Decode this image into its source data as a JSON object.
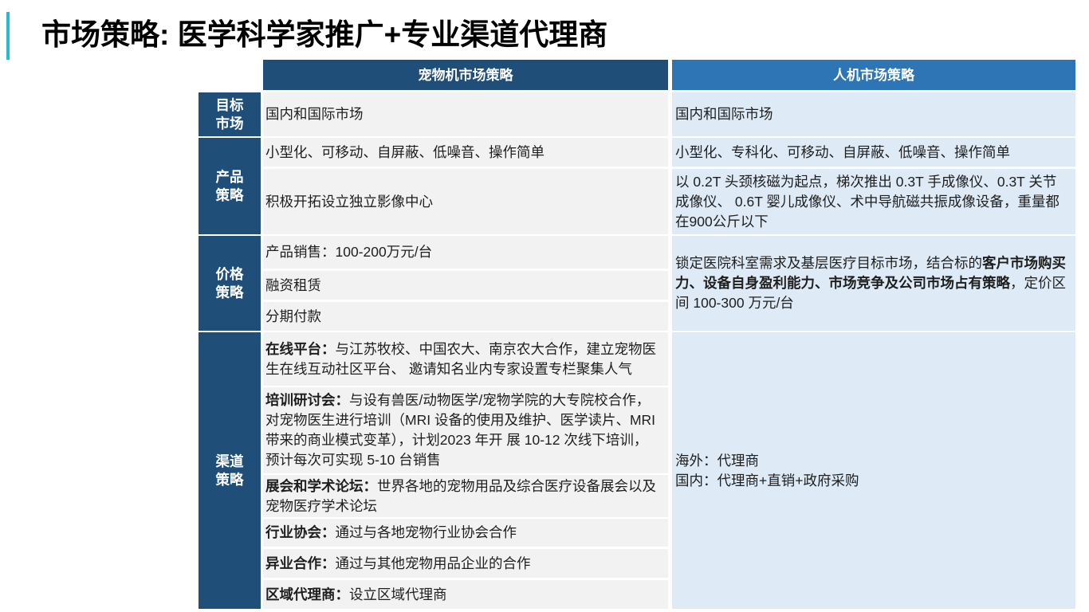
{
  "title": "市场策略: 医学科学家推广+专业渠道代理商",
  "colors": {
    "accent_bar": "#2BB9D0",
    "title_text": "#000000",
    "pet_header_bg": "#1F4E79",
    "human_header_bg": "#2E75B6",
    "row_label_bg": "#1F4E79",
    "pet_cell_bg": "#F2F2F2",
    "human_cell_bg": "#DEEBF7"
  },
  "table": {
    "headers": {
      "pet": "宠物机市场策略",
      "human": "人机市场策略"
    },
    "rows": {
      "target_market": {
        "label": "目标市场",
        "pet": "国内和国际市场",
        "human": "国内和国际市场"
      },
      "product_strategy": {
        "label": "产品策略",
        "pet": [
          "小型化、可移动、自屏蔽、低噪音、操作简单",
          "积极开拓设立独立影像中心"
        ],
        "human": [
          "小型化、专科化、可移动、自屏蔽、低噪音、操作简单",
          "以 0.2T 头颈核磁为起点，梯次推出 0.3T 手成像仪、0.3T 关节成像仪、 0.6T 婴儿成像仪、术中导航磁共振成像设备，重量都在900公斤以下"
        ]
      },
      "price_strategy": {
        "label": "价格策略",
        "pet": [
          "产品销售：100-200万元/台",
          "融资租赁",
          "分期付款"
        ],
        "human": {
          "text_before": "锁定医院科室需求及基层医疗目标市场，结合标的",
          "emphasis": "客户市场购买力、设备自身盈利能力、市场竞争及公司市场占有策略",
          "text_after": "，定价区间 100-300 万元/台"
        }
      },
      "channel_strategy": {
        "label": "渠道策略",
        "pet": [
          {
            "label": "在线平台：",
            "text": "与江苏牧校、中国农大、南京农大合作，建立宠物医生在线互动社区平台、 邀请知名业内专家设置专栏聚集人气"
          },
          {
            "label": "培训研讨会：",
            "text": "与设有兽医/动物医学/宠物学院的大专院校合作，对宠物医生进行培训（MRI 设备的使用及维护、医学读片、MRI 带来的商业模式变革），计划2023 年开 展 10-12 次线下培训，预计每次可实现 5-10 台销售"
          },
          {
            "label": "展会和学术论坛：",
            "text": "世界各地的宠物用品及综合医疗设备展会以及宠物医疗学术论坛"
          },
          {
            "label": "行业协会：",
            "text": "通过与各地宠物行业协会合作"
          },
          {
            "label": "异业合作：",
            "text": "通过与其他宠物用品企业的合作"
          },
          {
            "label": "区域代理商：",
            "text": "设立区域代理商"
          }
        ],
        "human": [
          "海外：代理商",
          "国内：代理商+直销+政府采购"
        ]
      }
    }
  }
}
